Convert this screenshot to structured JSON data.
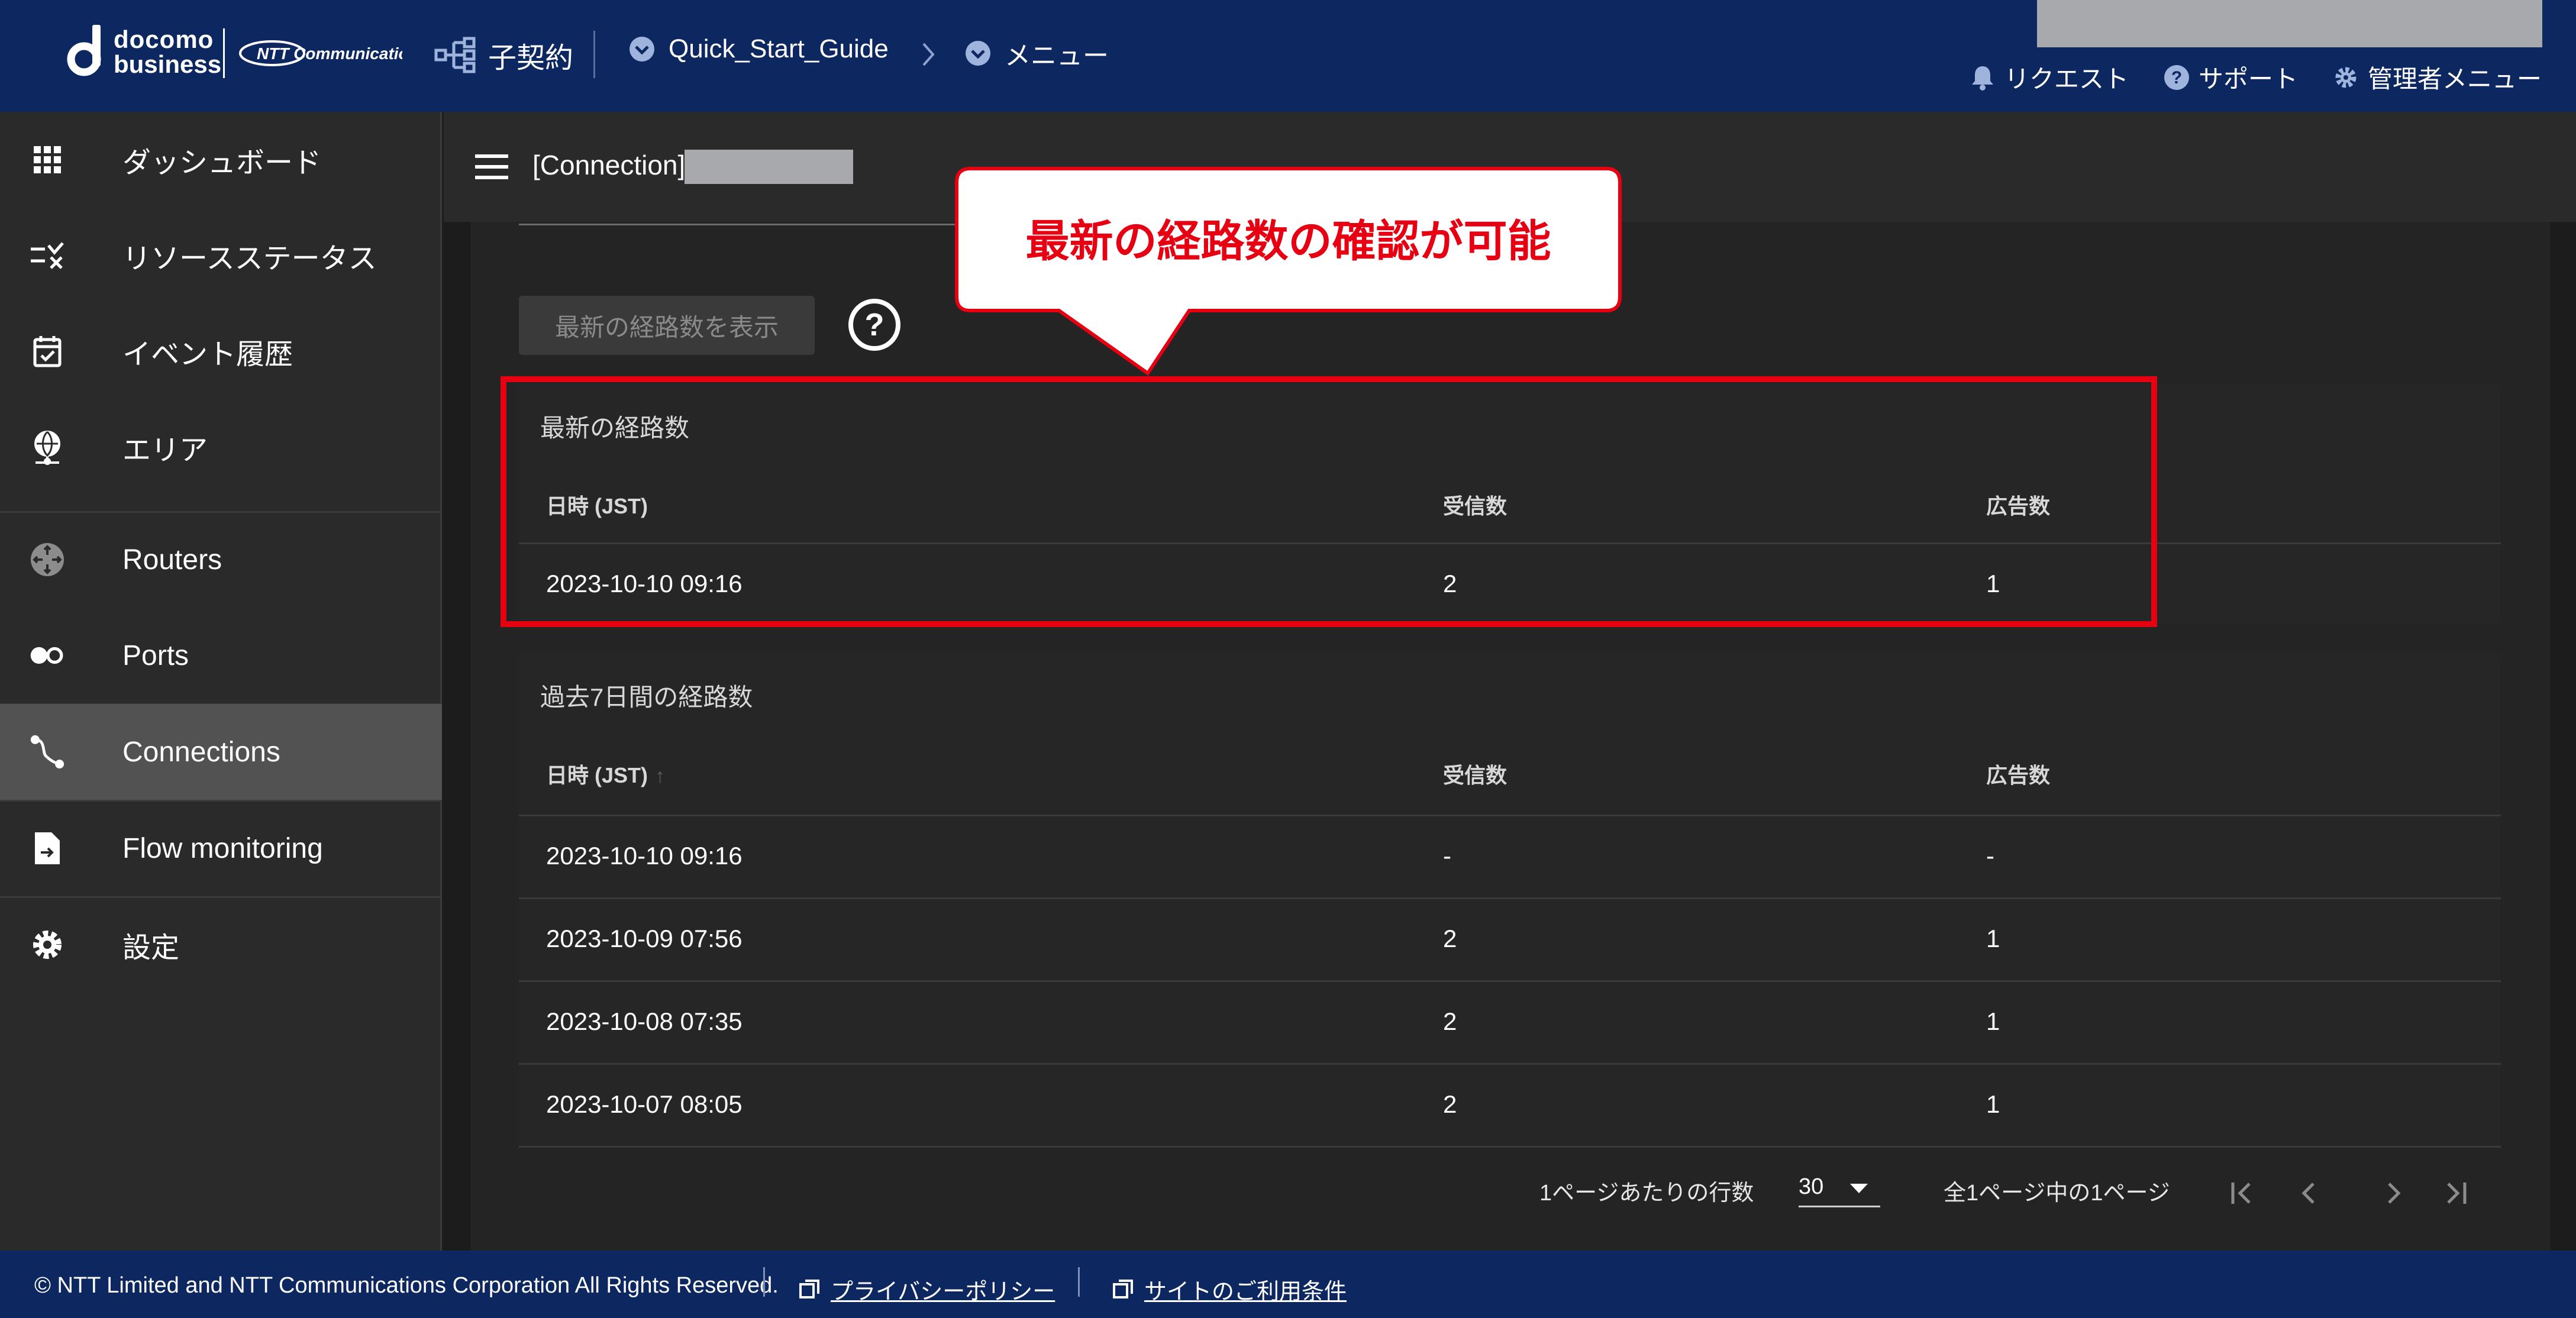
{
  "header": {
    "logo_docomo": "docomo",
    "logo_business": "business",
    "logo_ntt": "NTT Communications",
    "org_label": "子契約",
    "breadcrumb": [
      "Quick_Start_Guide",
      "メニュー"
    ],
    "links": [
      "リクエスト",
      "サポート",
      "管理者メニュー"
    ]
  },
  "sidebar": {
    "items": [
      {
        "label": "ダッシュボード",
        "icon": "grid-icon"
      },
      {
        "label": "リソースステータス",
        "icon": "checklist-icon"
      },
      {
        "label": "イベント履歴",
        "icon": "calendar-check-icon"
      },
      {
        "label": "エリア",
        "icon": "globe-pin-icon"
      },
      {
        "label": "Routers",
        "icon": "router-icon"
      },
      {
        "label": "Ports",
        "icon": "ports-icon"
      },
      {
        "label": "Connections",
        "icon": "connection-icon"
      },
      {
        "label": "Flow monitoring",
        "icon": "file-arrow-icon"
      },
      {
        "label": "設定",
        "icon": "gear-icon"
      }
    ],
    "active": "Connections"
  },
  "main": {
    "title": "[Connection]",
    "show_latest_button": "最新の経路数を表示",
    "latest": {
      "title": "最新の経路数",
      "headers": [
        "日時 (JST)",
        "受信数",
        "広告数"
      ],
      "rows": [
        [
          "2023-10-10 09:16",
          "2",
          "1"
        ]
      ]
    },
    "history": {
      "title": "過去7日間の経路数",
      "headers": [
        "日時 (JST)",
        "受信数",
        "広告数"
      ],
      "sort_indicator": "↑",
      "rows": [
        [
          "2023-10-10 09:16",
          "-",
          "-"
        ],
        [
          "2023-10-09 07:56",
          "2",
          "1"
        ],
        [
          "2023-10-08 07:35",
          "2",
          "1"
        ],
        [
          "2023-10-07 08:05",
          "2",
          "1"
        ]
      ]
    },
    "pagination": {
      "rows_per_page_label": "1ページあたりの行数",
      "rows_per_page_value": "30",
      "page_info": "全1ページ中の1ページ"
    }
  },
  "annotation": {
    "callout_text": "最新の経路数の確認が可能",
    "color": "#e60012"
  },
  "footer": {
    "copyright": "© NTT Limited and NTT Communications Corporation All Rights Reserved.",
    "privacy": "プライバシーポリシー",
    "terms": "サイトのご利用条件"
  },
  "colors": {
    "header_bg": "#0d2760",
    "sidebar_bg": "#2a2a2a",
    "active_item_bg": "#525252",
    "content_bg": "#242424"
  }
}
